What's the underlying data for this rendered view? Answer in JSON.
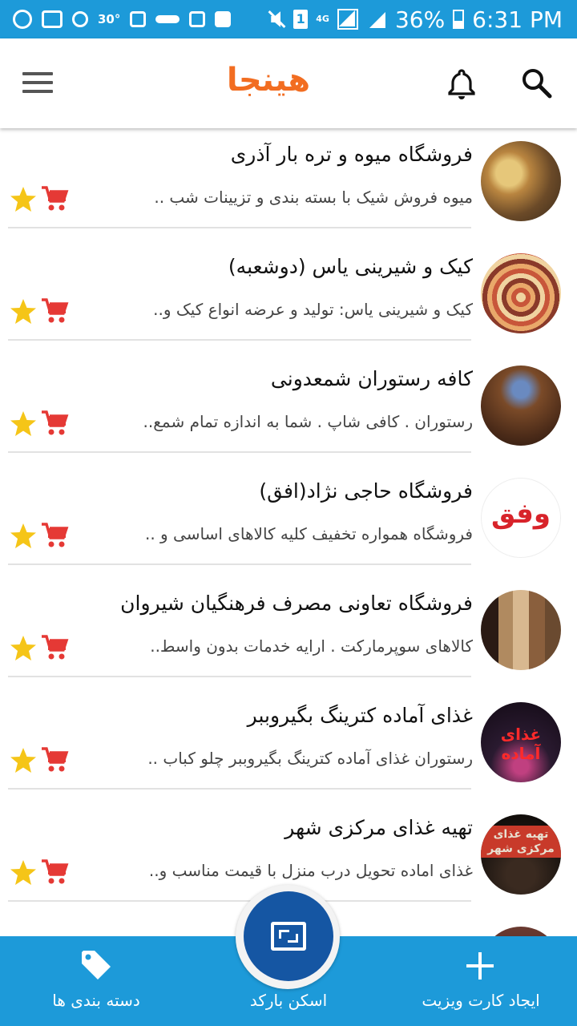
{
  "status_bar": {
    "temperature": "30°",
    "sim_slot": "1",
    "network_type": "4G",
    "battery": "36%",
    "time": "6:31 PM"
  },
  "app_bar": {
    "logo_text": "هینجا",
    "menu_icon": "hamburger-menu-icon",
    "notification_icon": "bell-icon",
    "search_icon": "search-icon",
    "accent_color": "#f26d21"
  },
  "listings": [
    {
      "title": "فروشگاه میوه و تره بار  آذری",
      "description": "میوه فروش شیک با بسته بندی و تزیینات شب ..",
      "thumb_caption": "",
      "thumb_bg": "#8a6a3a"
    },
    {
      "title": "کیک و شیرینی یاس (دوشعبه)",
      "description": "کیک و شیرینی یاس: تولید و عرضه انواع کیک و..",
      "thumb_caption": "",
      "thumb_bg": "#c8563a"
    },
    {
      "title": "کافه رستوران شمعدونی",
      "description": "رستوران . کافی شاپ .  شما به اندازه تمام شمع..",
      "thumb_caption": "",
      "thumb_bg": "#5a3a22"
    },
    {
      "title": "فروشگاه حاجی نژاد(افق)",
      "description": "فروشگاه همواره تخفیف کلیه کالاهای اساسی و ..",
      "thumb_caption": "وفق",
      "thumb_bg": "#ffffff"
    },
    {
      "title": "فروشگاه تعاونی مصرف فرهنگیان شیروان",
      "description": "کالاهای سوپرمارکت .   ارایه خدمات بدون واسط..",
      "thumb_caption": "",
      "thumb_bg": "#8a5f3d"
    },
    {
      "title": "غذای آماده کترینگ بگیروببر",
      "description": "رستوران غذای آماده کترینگ بگیروببر چلو کباب ..",
      "thumb_caption": "غذای آماده",
      "thumb_bg": "#2a1a30"
    },
    {
      "title": "تهیه غذای مرکزی شهر",
      "description": "غذای اماده  تحویل درب منزل با قیمت مناسب و..",
      "thumb_caption": "تهیه غذای مرکزی شهر",
      "thumb_bg": "#1a1410"
    },
    {
      "title": "",
      "description": "",
      "thumb_caption": "",
      "thumb_bg": "#5a2a28"
    }
  ],
  "item_icons": {
    "favorite": "star-icon",
    "shop": "cart-icon",
    "star_color": "#f5c518",
    "cart_color": "#e53935"
  },
  "bottom_nav": {
    "categories_label": "دسته بندی ها",
    "scan_label": "اسکن بارکد",
    "create_label": "ایجاد کارت ویزیت",
    "bar_color": "#1d9ad9",
    "fab_color": "#1556a3"
  }
}
